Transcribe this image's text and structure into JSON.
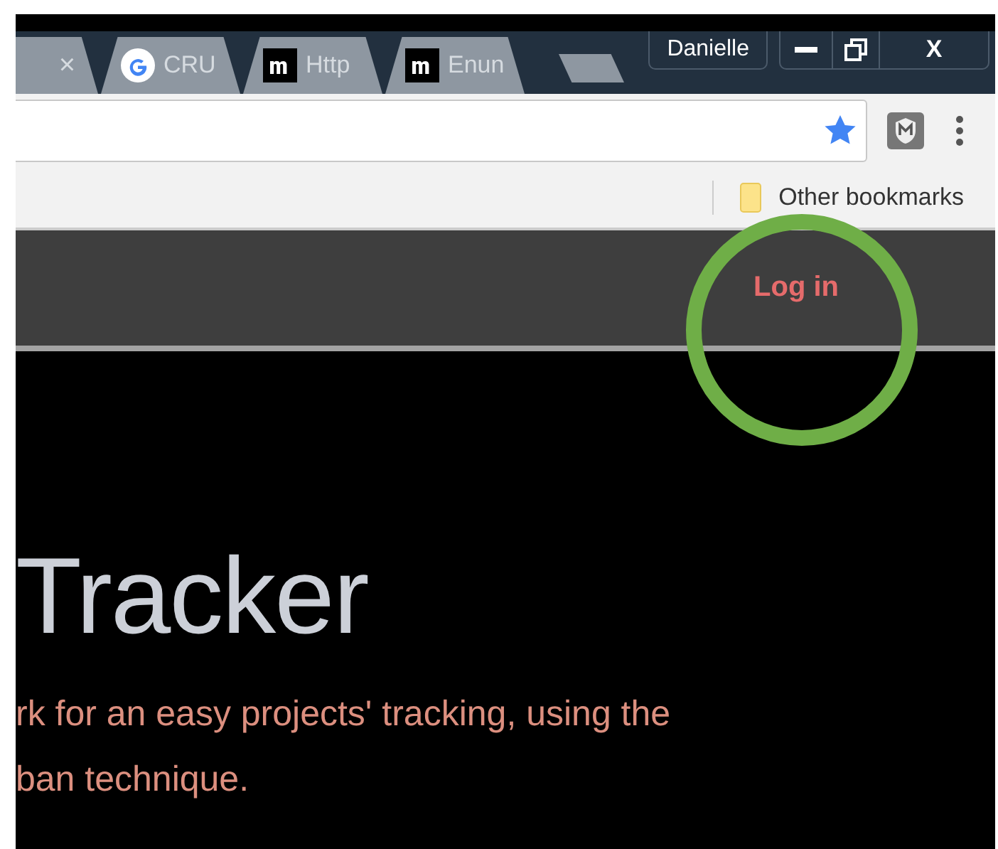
{
  "tabs": [
    {
      "kind": "plain",
      "close": "×",
      "selected": false
    },
    {
      "kind": "google",
      "title": "CRU",
      "selected": false
    },
    {
      "kind": "letter",
      "title": "Http",
      "selected": false
    },
    {
      "kind": "letter",
      "title": "Enun",
      "selected": false
    }
  ],
  "profile": "Danielle",
  "window_controls": {
    "close": "X"
  },
  "bookmarks": [
    {
      "label": "Other bookmarks"
    }
  ],
  "nav": {
    "login": "Log in"
  },
  "hero": {
    "title": "Tracker",
    "subtitle_lines": [
      "rk for an easy projects' tracking, using the",
      "ban technique."
    ]
  }
}
